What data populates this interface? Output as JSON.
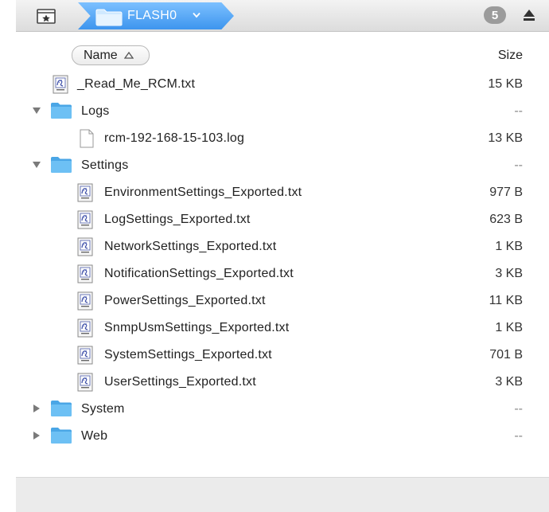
{
  "path_bar": {
    "favorite_icon": "star-drawer-icon",
    "current_folder": "FLASH0",
    "item_count_badge": "5",
    "eject_icon": "eject-icon"
  },
  "header": {
    "name_label": "Name",
    "size_label": "Size",
    "sort": "ascending"
  },
  "files": [
    {
      "name": "_Read_Me_RCM.txt",
      "size": "15 KB",
      "type": "txt",
      "depth": 0
    },
    {
      "name": "Logs",
      "size": "--",
      "type": "folder",
      "expanded": true,
      "depth": 0
    },
    {
      "name": "rcm-192-168-15-103.log",
      "size": "13 KB",
      "type": "log",
      "depth": 1
    },
    {
      "name": "Settings",
      "size": "--",
      "type": "folder",
      "expanded": true,
      "depth": 0
    },
    {
      "name": "EnvironmentSettings_Exported.txt",
      "size": "977 B",
      "type": "txt",
      "depth": 1
    },
    {
      "name": "LogSettings_Exported.txt",
      "size": "623 B",
      "type": "txt",
      "depth": 1
    },
    {
      "name": "NetworkSettings_Exported.txt",
      "size": "1 KB",
      "type": "txt",
      "depth": 1
    },
    {
      "name": "NotificationSettings_Exported.txt",
      "size": "3 KB",
      "type": "txt",
      "depth": 1
    },
    {
      "name": "PowerSettings_Exported.txt",
      "size": "11 KB",
      "type": "txt",
      "depth": 1
    },
    {
      "name": "SnmpUsmSettings_Exported.txt",
      "size": "1 KB",
      "type": "txt",
      "depth": 1
    },
    {
      "name": "SystemSettings_Exported.txt",
      "size": "701 B",
      "type": "txt",
      "depth": 1
    },
    {
      "name": "UserSettings_Exported.txt",
      "size": "3 KB",
      "type": "txt",
      "depth": 1
    },
    {
      "name": "System",
      "size": "--",
      "type": "folder",
      "expanded": false,
      "depth": 0
    },
    {
      "name": "Web",
      "size": "--",
      "type": "folder",
      "expanded": false,
      "depth": 0
    }
  ],
  "colors": {
    "path_accent": "#3d95ee",
    "folder_blue": "#5fb4ec",
    "badge_gray": "#9b9b9b"
  }
}
